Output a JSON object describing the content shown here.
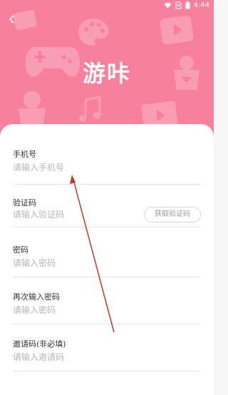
{
  "status_bar": {
    "time": "4:44"
  },
  "header": {
    "title": "游咔"
  },
  "form": {
    "phone": {
      "label": "手机号",
      "placeholder": "请输入手机号"
    },
    "code": {
      "label": "验证码",
      "placeholder": "请输入验证码",
      "button": "获取验证码"
    },
    "password": {
      "label": "密码",
      "placeholder": "请输入密码"
    },
    "password_confirm": {
      "label": "再次输入密码",
      "placeholder": "请输入密码"
    },
    "invite": {
      "label": "邀请码(非必填)",
      "placeholder": "请输入邀请码"
    }
  },
  "colors": {
    "brand": "#f7819c",
    "arrow": "#c0392b"
  }
}
